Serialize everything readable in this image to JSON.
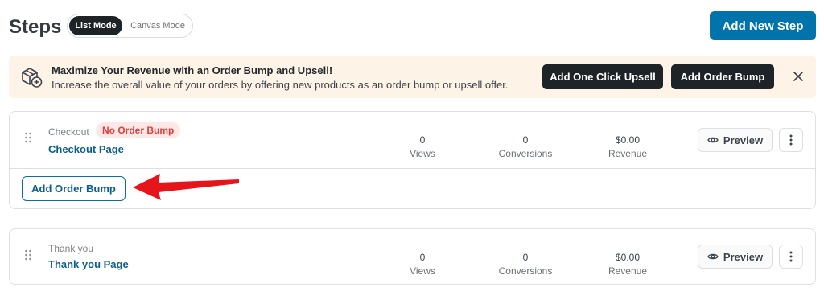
{
  "header": {
    "title": "Steps",
    "modes": [
      "List Mode",
      "Canvas Mode"
    ],
    "active_mode": "List Mode",
    "add_step_label": "Add New Step"
  },
  "banner": {
    "icon": "box-plus-icon",
    "title": "Maximize Your Revenue with an Order Bump and Upsell!",
    "text": "Increase the overall value of your orders by offering new products as an order bump or upsell offer.",
    "upsell_label": "Add One Click Upsell",
    "bump_label": "Add Order Bump",
    "close_icon": "close-icon"
  },
  "steps": [
    {
      "type": "Checkout",
      "badge": "No Order Bump",
      "name": "Checkout Page",
      "views": "0",
      "views_label": "Views",
      "conversions": "0",
      "conversions_label": "Conversions",
      "revenue": "$0.00",
      "revenue_label": "Revenue",
      "preview_label": "Preview",
      "add_bump_label": "Add Order Bump"
    },
    {
      "type": "Thank you",
      "name": "Thank you Page",
      "views": "0",
      "views_label": "Views",
      "conversions": "0",
      "conversions_label": "Conversions",
      "revenue": "$0.00",
      "revenue_label": "Revenue",
      "preview_label": "Preview"
    }
  ],
  "colors": {
    "primary": "#0073aa",
    "dark_button": "#1e2327",
    "banner_bg": "#fdf3e7",
    "badge_bg": "#fde8e7",
    "badge_text": "#d9423c",
    "annotation_arrow": "#e8141b"
  }
}
